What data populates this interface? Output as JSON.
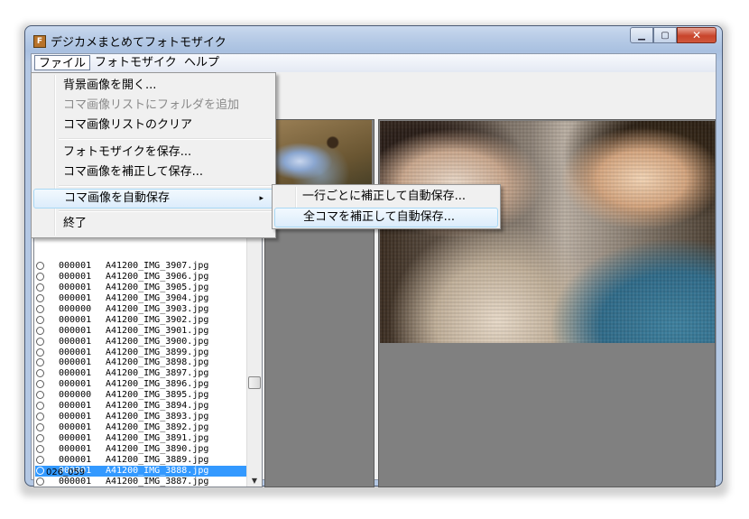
{
  "window": {
    "title": "デジカメまとめてフォトモザイク",
    "icon": "app-icon",
    "controls": {
      "minimize": "minimize-icon",
      "maximize": "maximize-icon",
      "close": "close-icon"
    }
  },
  "menubar": {
    "items": [
      {
        "label": "ファイル",
        "active": true
      },
      {
        "label": "フォトモザイク",
        "active": false
      },
      {
        "label": "ヘルプ",
        "active": false
      }
    ]
  },
  "file_menu": {
    "items": [
      {
        "label": "背景画像を開く...",
        "enabled": true
      },
      {
        "label": "コマ画像リストにフォルダを追加",
        "enabled": false
      },
      {
        "label": "コマ画像リストのクリア",
        "enabled": true
      },
      {
        "label": "フォトモザイクを保存...",
        "enabled": true
      },
      {
        "label": "コマ画像を補正して保存...",
        "enabled": true
      },
      {
        "label": "コマ画像を自動保存",
        "enabled": true,
        "submenu_arrow": "▸"
      },
      {
        "label": "終了",
        "enabled": true
      }
    ]
  },
  "auto_save_submenu": {
    "items": [
      {
        "label": "一行ごとに補正して自動保存..."
      },
      {
        "label": "全コマを補正して自動保存..."
      }
    ]
  },
  "image_list": {
    "rows": [
      {
        "count": "000001",
        "file": "A41200_IMG_3907.jpg"
      },
      {
        "count": "000001",
        "file": "A41200_IMG_3906.jpg"
      },
      {
        "count": "000001",
        "file": "A41200_IMG_3905.jpg"
      },
      {
        "count": "000001",
        "file": "A41200_IMG_3904.jpg"
      },
      {
        "count": "000000",
        "file": "A41200_IMG_3903.jpg"
      },
      {
        "count": "000001",
        "file": "A41200_IMG_3902.jpg"
      },
      {
        "count": "000001",
        "file": "A41200_IMG_3901.jpg"
      },
      {
        "count": "000001",
        "file": "A41200_IMG_3900.jpg"
      },
      {
        "count": "000001",
        "file": "A41200_IMG_3899.jpg"
      },
      {
        "count": "000001",
        "file": "A41200_IMG_3898.jpg"
      },
      {
        "count": "000001",
        "file": "A41200_IMG_3897.jpg"
      },
      {
        "count": "000001",
        "file": "A41200_IMG_3896.jpg"
      },
      {
        "count": "000000",
        "file": "A41200_IMG_3895.jpg"
      },
      {
        "count": "000001",
        "file": "A41200_IMG_3894.jpg"
      },
      {
        "count": "000001",
        "file": "A41200_IMG_3893.jpg"
      },
      {
        "count": "000001",
        "file": "A41200_IMG_3892.jpg"
      },
      {
        "count": "000001",
        "file": "A41200_IMG_3891.jpg"
      },
      {
        "count": "000001",
        "file": "A41200_IMG_3890.jpg"
      },
      {
        "count": "000001",
        "file": "A41200_IMG_3889.jpg"
      },
      {
        "count": "000001",
        "file": "A41200_IMG_3888.jpg",
        "selected": true
      },
      {
        "count": "000001",
        "file": "A41200_IMG_3887.jpg"
      }
    ]
  },
  "statusbar": {
    "text": "026_059"
  }
}
